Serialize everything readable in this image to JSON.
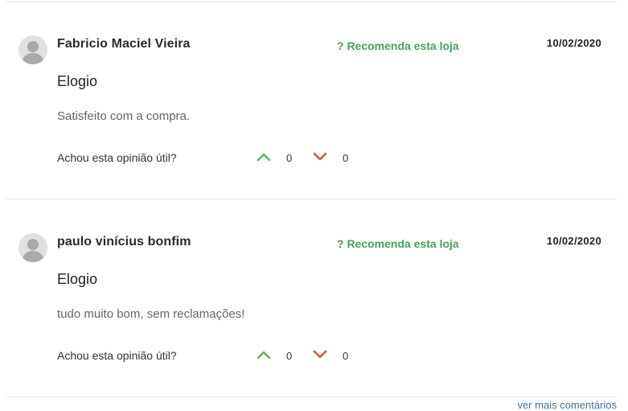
{
  "reviews": [
    {
      "author": "Fabricio Maciel Vieira",
      "recommend": "? Recomenda esta loja",
      "date": "10/02/2020",
      "title": "Elogio",
      "text": "Satisfeito com a compra.",
      "helpful_label": "Achou esta opinião útil?",
      "upvotes": "0",
      "downvotes": "0"
    },
    {
      "author": "paulo vinícius bonfim",
      "recommend": "? Recomenda esta loja",
      "date": "10/02/2020",
      "title": "Elogio",
      "text": "tudo muito bom, sem reclamações!",
      "helpful_label": "Achou esta opinião útil?",
      "upvotes": "0",
      "downvotes": "0"
    }
  ],
  "more_comments": "ver mais comentários",
  "icons": {
    "avatar": "user-avatar-icon",
    "upvote": "chevron-up-icon",
    "downvote": "chevron-down-icon"
  },
  "colors": {
    "recommend": "#4aa05a",
    "upvote": "#5cb85c",
    "downvote": "#d9534f",
    "link": "#3c74a3"
  }
}
